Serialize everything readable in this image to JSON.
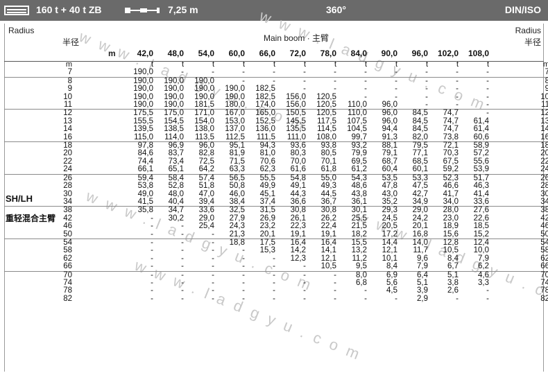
{
  "title_bar": {
    "config": "160 t + 40 t ZB",
    "counter_radius": "7,25 m",
    "slewing": "360°",
    "norm": "DIN/ISO"
  },
  "header": {
    "radius_en_left": "Radius",
    "radius_zh_left": "半径",
    "radius_en_right": "Radius",
    "radius_zh_right": "半径",
    "boom_label": "Main boom · 主臂",
    "boom_unit": "m",
    "boom_lengths": [
      "42,0",
      "48,0",
      "54,0",
      "60,0",
      "66,0",
      "72,0",
      "78,0",
      "84,0",
      "90,0",
      "96,0",
      "102,0",
      "108,0"
    ]
  },
  "side_label": {
    "code": "SH/LH",
    "zh": "重轻混合主臂"
  },
  "watermark": "www.ladgyu.com",
  "units": {
    "radius": "m",
    "capacity": "t"
  },
  "rows": [
    {
      "r": "7",
      "v": [
        "190,0",
        "-",
        "-",
        "-",
        "-",
        "-",
        "-",
        "-",
        "-",
        "-",
        "-",
        "-"
      ]
    },
    {
      "r": "8",
      "v": [
        "190,0",
        "190,0",
        "190,0",
        "-",
        "-",
        "-",
        "-",
        "-",
        "-",
        "-",
        "-",
        "-"
      ]
    },
    {
      "r": "9",
      "v": [
        "190,0",
        "190,0",
        "190,0",
        "190,0",
        "182,5",
        "-",
        "-",
        "-",
        "-",
        "-",
        "-",
        "-"
      ]
    },
    {
      "r": "10",
      "v": [
        "190,0",
        "190,0",
        "190,0",
        "190,0",
        "182,5",
        "156,0",
        "120,5",
        "-",
        "-",
        "-",
        "-",
        "-"
      ]
    },
    {
      "r": "11",
      "v": [
        "190,0",
        "190,0",
        "181,5",
        "180,0",
        "174,0",
        "156,0",
        "120,5",
        "110,0",
        "96,0",
        "-",
        "-",
        "-"
      ]
    },
    {
      "r": "12",
      "v": [
        "175,5",
        "175,0",
        "171,0",
        "167,0",
        "165,0",
        "150,5",
        "120,5",
        "110,0",
        "96,0",
        "84,5",
        "74,7",
        "-"
      ]
    },
    {
      "r": "13",
      "v": [
        "155,5",
        "154,5",
        "154,0",
        "153,0",
        "152,5",
        "145,5",
        "117,5",
        "107,5",
        "96,0",
        "84,5",
        "74,7",
        "61,4"
      ]
    },
    {
      "r": "14",
      "v": [
        "139,5",
        "138,5",
        "138,0",
        "137,0",
        "136,0",
        "135,5",
        "114,5",
        "104,5",
        "94,4",
        "84,5",
        "74,7",
        "61,4"
      ]
    },
    {
      "r": "16",
      "v": [
        "115,0",
        "114,0",
        "113,5",
        "112,5",
        "111,5",
        "111,0",
        "108,0",
        "99,7",
        "91,3",
        "82,0",
        "73,8",
        "60,6"
      ]
    },
    {
      "r": "18",
      "v": [
        "97,8",
        "96,9",
        "96,0",
        "95,1",
        "94,3",
        "93,6",
        "93,8",
        "93,2",
        "88,1",
        "79,5",
        "72,1",
        "58,9"
      ]
    },
    {
      "r": "20",
      "v": [
        "84,6",
        "83,7",
        "82,8",
        "81,9",
        "81,0",
        "80,3",
        "80,5",
        "79,9",
        "79,1",
        "77,1",
        "70,3",
        "57,2"
      ]
    },
    {
      "r": "22",
      "v": [
        "74,4",
        "73,4",
        "72,5",
        "71,5",
        "70,6",
        "70,0",
        "70,1",
        "69,5",
        "68,7",
        "68,5",
        "67,5",
        "55,6"
      ]
    },
    {
      "r": "24",
      "v": [
        "66,1",
        "65,1",
        "64,2",
        "63,3",
        "62,3",
        "61,6",
        "61,8",
        "61,2",
        "60,4",
        "60,1",
        "59,2",
        "53,9"
      ]
    },
    {
      "r": "26",
      "v": [
        "59,4",
        "58,4",
        "57,4",
        "56,5",
        "55,5",
        "54,8",
        "55,0",
        "54,3",
        "53,5",
        "53,3",
        "52,3",
        "51,7"
      ]
    },
    {
      "r": "28",
      "v": [
        "53,8",
        "52,8",
        "51,8",
        "50,8",
        "49,9",
        "49,1",
        "49,3",
        "48,6",
        "47,8",
        "47,5",
        "46,6",
        "46,3"
      ]
    },
    {
      "r": "30",
      "v": [
        "49,0",
        "48,0",
        "47,0",
        "46,0",
        "45,1",
        "44,3",
        "44,5",
        "43,8",
        "43,0",
        "42,7",
        "41,7",
        "41,4"
      ]
    },
    {
      "r": "34",
      "v": [
        "41,5",
        "40,4",
        "39,4",
        "38,4",
        "37,4",
        "36,6",
        "36,7",
        "36,1",
        "35,2",
        "34,9",
        "34,0",
        "33,6"
      ]
    },
    {
      "r": "38",
      "v": [
        "35,8",
        "34,7",
        "33,6",
        "32,5",
        "31,5",
        "30,8",
        "30,8",
        "30,1",
        "29,3",
        "29,0",
        "28,0",
        "27,6"
      ]
    },
    {
      "r": "42",
      "v": [
        "-",
        "30,2",
        "29,0",
        "27,9",
        "26,9",
        "26,1",
        "26,2",
        "25,5",
        "24,5",
        "24,2",
        "23,0",
        "22,6"
      ]
    },
    {
      "r": "46",
      "v": [
        "-",
        "-",
        "25,4",
        "24,3",
        "23,2",
        "22,3",
        "22,4",
        "21,5",
        "20,5",
        "20,1",
        "18,9",
        "18,5"
      ]
    },
    {
      "r": "50",
      "v": [
        "-",
        "-",
        "-",
        "21,3",
        "20,1",
        "19,1",
        "19,1",
        "18,2",
        "17,2",
        "16,8",
        "15,6",
        "15,2"
      ]
    },
    {
      "r": "54",
      "v": [
        "-",
        "-",
        "-",
        "18,8",
        "17,5",
        "16,4",
        "16,4",
        "15,5",
        "14,4",
        "14,0",
        "12,8",
        "12,4"
      ]
    },
    {
      "r": "58",
      "v": [
        "-",
        "-",
        "-",
        "-",
        "15,3",
        "14,2",
        "14,1",
        "13,2",
        "12,1",
        "11,7",
        "10,5",
        "10,0"
      ]
    },
    {
      "r": "62",
      "v": [
        "-",
        "-",
        "-",
        "-",
        "-",
        "12,3",
        "12,1",
        "11,2",
        "10,1",
        "9,6",
        "8,4",
        "7,9"
      ]
    },
    {
      "r": "66",
      "v": [
        "-",
        "-",
        "-",
        "-",
        "-",
        "-",
        "10,5",
        "9,5",
        "8,4",
        "7,9",
        "6,7",
        "6,2"
      ]
    },
    {
      "r": "70",
      "v": [
        "-",
        "-",
        "-",
        "-",
        "-",
        "-",
        "-",
        "8,0",
        "6,9",
        "6,4",
        "5,1",
        "4,6"
      ]
    },
    {
      "r": "74",
      "v": [
        "-",
        "-",
        "-",
        "-",
        "-",
        "-",
        "-",
        "6,8",
        "5,6",
        "5,1",
        "3,8",
        "3,3"
      ]
    },
    {
      "r": "78",
      "v": [
        "-",
        "-",
        "-",
        "-",
        "-",
        "-",
        "-",
        "-",
        "4,5",
        "3,9",
        "2,6",
        "-"
      ]
    },
    {
      "r": "82",
      "v": [
        "-",
        "-",
        "-",
        "-",
        "-",
        "-",
        "-",
        "-",
        "-",
        "2,9",
        "-",
        "-"
      ]
    }
  ]
}
